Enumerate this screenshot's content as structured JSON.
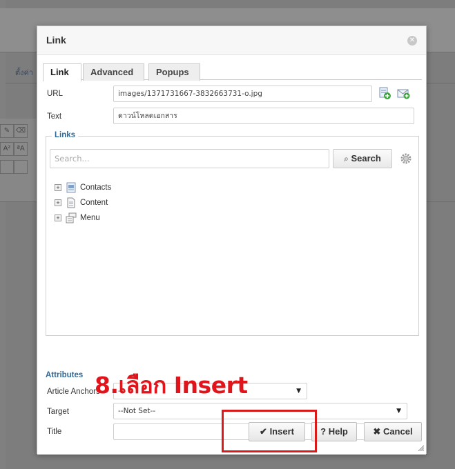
{
  "background": {
    "label": "ตั้งค่า"
  },
  "dialog": {
    "title": "Link",
    "tabs": [
      {
        "label": "Link",
        "active": true
      },
      {
        "label": "Advanced",
        "active": false
      },
      {
        "label": "Popups",
        "active": false
      }
    ],
    "url": {
      "label": "URL",
      "value": "images/1371731667-3832663731-o.jpg"
    },
    "text": {
      "label": "Text",
      "value": "ดาวน์โหลดเอกสาร"
    },
    "links": {
      "legend": "Links",
      "search_placeholder": "Search...",
      "search_button": "Search",
      "tree": [
        {
          "label": "Contacts",
          "icon": "contacts-icon"
        },
        {
          "label": "Content",
          "icon": "content-icon"
        },
        {
          "label": "Menu",
          "icon": "menu-icon"
        }
      ]
    },
    "attributes": {
      "title": "Attributes",
      "article_anchors": {
        "label": "Article Anchors",
        "value": "---"
      },
      "target": {
        "label": "Target",
        "value": "--Not Set--"
      },
      "title_field": {
        "label": "Title",
        "value": ""
      }
    },
    "buttons": {
      "insert": "Insert",
      "help": "Help",
      "cancel": "Cancel"
    }
  },
  "annotation": {
    "text": "8.เลือก Insert",
    "color": "#e0141a"
  }
}
